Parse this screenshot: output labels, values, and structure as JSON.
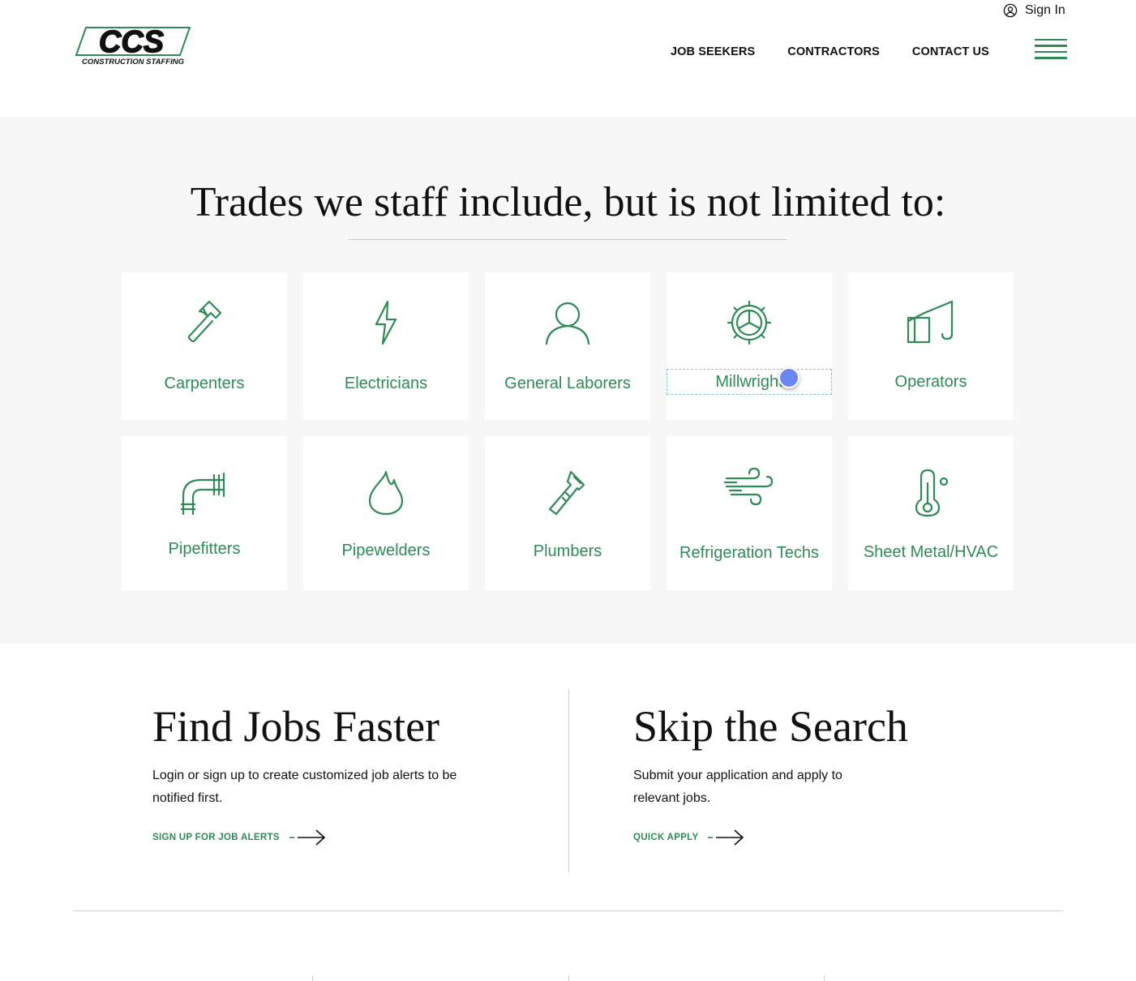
{
  "header": {
    "signin_label": "Sign In",
    "logo_text": "CCS",
    "logo_subtext": "CONSTRUCTION STAFFING",
    "nav": [
      "JOB SEEKERS",
      "CONTRACTORS",
      "CONTACT US"
    ],
    "accent_color": "#2f8a55"
  },
  "trades": {
    "title": "Trades we staff include, but is not limited to:",
    "items": [
      {
        "label": "Carpenters",
        "icon": "hammer-icon"
      },
      {
        "label": "Electricians",
        "icon": "lightning-icon"
      },
      {
        "label": "General Laborers",
        "icon": "person-icon"
      },
      {
        "label": "Millwright",
        "icon": "gear-icon"
      },
      {
        "label": "Operators",
        "icon": "crane-icon"
      },
      {
        "label": "Pipefitters",
        "icon": "pipe-icon"
      },
      {
        "label": "Pipewelders",
        "icon": "flame-icon"
      },
      {
        "label": "Plumbers",
        "icon": "wrench-icon"
      },
      {
        "label": "Refrigeration Techs",
        "icon": "wind-icon"
      },
      {
        "label": "Sheet Metal/HVAC",
        "icon": "thermometer-icon"
      }
    ]
  },
  "find_jobs": {
    "title": "Find Jobs Faster",
    "body": "Login or sign up to create customized job alerts to be notified first.",
    "link": "SIGN UP FOR JOB ALERTS"
  },
  "skip_search": {
    "title": "Skip the Search",
    "body": "Submit your application and apply to relevant jobs.",
    "link": "QUICK APPLY"
  }
}
